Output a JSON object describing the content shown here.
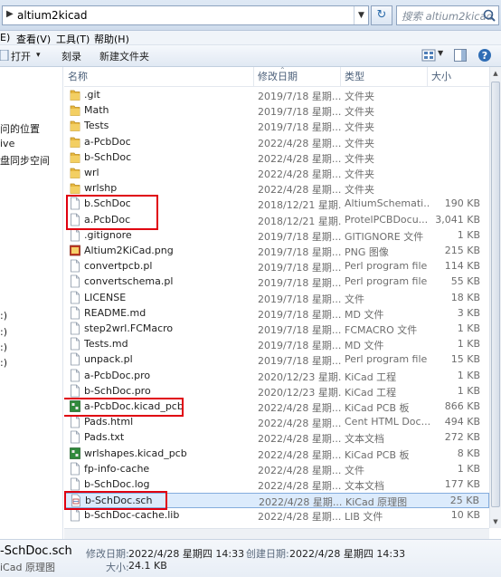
{
  "address": {
    "path": "altium2kicad",
    "arrow": "▶"
  },
  "search": {
    "placeholder": "搜索 altium2kicad"
  },
  "menu": [
    "E)",
    "查看(V)",
    "工具(T)",
    "帮助(H)"
  ],
  "toolbar": {
    "open_label": "打开",
    "open_dd": "▾",
    "burn_label": "刻录",
    "new_folder_label": "新建文件夹"
  },
  "columns": {
    "name": "名称",
    "date": "修改日期",
    "type": "类型",
    "size": "大小"
  },
  "nav": [
    {
      "label": "问的位置"
    },
    {
      "label": "ive"
    },
    {
      "label": "盘同步空间"
    },
    {
      "label": ":)"
    },
    {
      "label": ":)"
    },
    {
      "label": ":)"
    },
    {
      "label": ":)"
    },
    {
      "label": ":)"
    }
  ],
  "files": [
    {
      "name": ".git",
      "date": "2019/7/18 星期...",
      "type": "文件夹",
      "size": "",
      "icon": "folder"
    },
    {
      "name": "Math",
      "date": "2019/7/18 星期...",
      "type": "文件夹",
      "size": "",
      "icon": "folder"
    },
    {
      "name": "Tests",
      "date": "2019/7/18 星期...",
      "type": "文件夹",
      "size": "",
      "icon": "folder"
    },
    {
      "name": "a-PcbDoc",
      "date": "2022/4/28 星期...",
      "type": "文件夹",
      "size": "",
      "icon": "folder"
    },
    {
      "name": "b-SchDoc",
      "date": "2022/4/28 星期...",
      "type": "文件夹",
      "size": "",
      "icon": "folder"
    },
    {
      "name": "wrl",
      "date": "2022/4/28 星期...",
      "type": "文件夹",
      "size": "",
      "icon": "folder"
    },
    {
      "name": "wrlshp",
      "date": "2022/4/28 星期...",
      "type": "文件夹",
      "size": "",
      "icon": "folder"
    },
    {
      "name": "b.SchDoc",
      "date": "2018/12/21 星期...",
      "type": "AltiumSchemati...",
      "size": "190 KB",
      "icon": "doc"
    },
    {
      "name": "a.PcbDoc",
      "date": "2018/12/21 星期...",
      "type": "ProtelPCBDocu...",
      "size": "3,041 KB",
      "icon": "doc"
    },
    {
      "name": ".gitignore",
      "date": "2019/7/18 星期...",
      "type": "GITIGNORE 文件",
      "size": "1 KB",
      "icon": "doc"
    },
    {
      "name": "Altium2KiCad.png",
      "date": "2019/7/18 星期...",
      "type": "PNG 图像",
      "size": "215 KB",
      "icon": "image"
    },
    {
      "name": "convertpcb.pl",
      "date": "2019/7/18 星期...",
      "type": "Perl program file",
      "size": "114 KB",
      "icon": "doc"
    },
    {
      "name": "convertschema.pl",
      "date": "2019/7/18 星期...",
      "type": "Perl program file",
      "size": "55 KB",
      "icon": "doc"
    },
    {
      "name": "LICENSE",
      "date": "2019/7/18 星期...",
      "type": "文件",
      "size": "18 KB",
      "icon": "doc"
    },
    {
      "name": "README.md",
      "date": "2019/7/18 星期...",
      "type": "MD 文件",
      "size": "3 KB",
      "icon": "doc"
    },
    {
      "name": "step2wrl.FCMacro",
      "date": "2019/7/18 星期...",
      "type": "FCMACRO 文件",
      "size": "1 KB",
      "icon": "doc"
    },
    {
      "name": "Tests.md",
      "date": "2019/7/18 星期...",
      "type": "MD 文件",
      "size": "1 KB",
      "icon": "doc"
    },
    {
      "name": "unpack.pl",
      "date": "2019/7/18 星期...",
      "type": "Perl program file",
      "size": "15 KB",
      "icon": "doc"
    },
    {
      "name": "a-PcbDoc.pro",
      "date": "2020/12/23 星期...",
      "type": "KiCad 工程",
      "size": "1 KB",
      "icon": "doc"
    },
    {
      "name": "b-SchDoc.pro",
      "date": "2020/12/23 星期...",
      "type": "KiCad 工程",
      "size": "1 KB",
      "icon": "doc"
    },
    {
      "name": "a-PcbDoc.kicad_pcb",
      "date": "2022/4/28 星期...",
      "type": "KiCad PCB 板",
      "size": "866 KB",
      "icon": "pcb"
    },
    {
      "name": "Pads.html",
      "date": "2022/4/28 星期...",
      "type": "Cent HTML Doc...",
      "size": "494 KB",
      "icon": "doc"
    },
    {
      "name": "Pads.txt",
      "date": "2022/4/28 星期...",
      "type": "文本文档",
      "size": "272 KB",
      "icon": "doc"
    },
    {
      "name": "wrlshapes.kicad_pcb",
      "date": "2022/4/28 星期...",
      "type": "KiCad PCB 板",
      "size": "8 KB",
      "icon": "pcb"
    },
    {
      "name": "fp-info-cache",
      "date": "2022/4/28 星期...",
      "type": "文件",
      "size": "1 KB",
      "icon": "doc"
    },
    {
      "name": "b-SchDoc.log",
      "date": "2022/4/28 星期...",
      "type": "文本文档",
      "size": "177 KB",
      "icon": "doc"
    },
    {
      "name": "b-SchDoc.sch",
      "date": "2022/4/28 星期...",
      "type": "KiCad 原理图",
      "size": "25 KB",
      "icon": "sch",
      "selected": true
    },
    {
      "name": "b-SchDoc-cache.lib",
      "date": "2022/4/28 星期...",
      "type": "LIB 文件",
      "size": "10 KB",
      "icon": "doc"
    }
  ],
  "details": {
    "name": "-SchDoc.sch",
    "type": "iCad 原理图",
    "modified_label": "修改日期:",
    "modified_value": "2022/4/28 星期四 14:33",
    "created_label": "创建日期:",
    "created_value": "2022/4/28 星期四 14:33",
    "size_label": "大小:",
    "size_value": "24.1 KB"
  },
  "colors": {
    "highlight_box": "#e00010",
    "selection": "#dcebfc",
    "folder": "#e6b740"
  }
}
